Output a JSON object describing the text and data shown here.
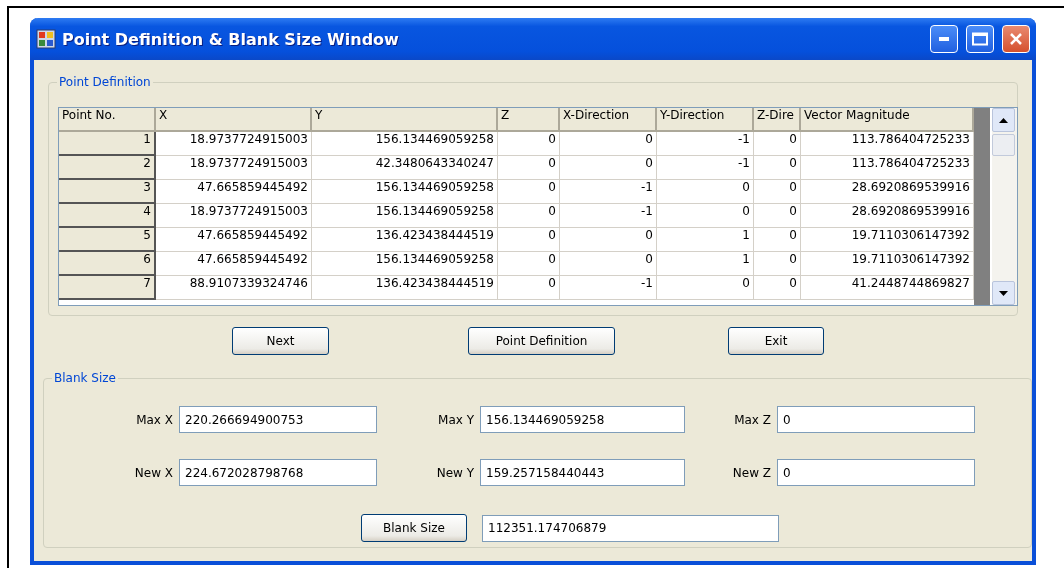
{
  "window": {
    "title": "Point Definition & Blank Size Window"
  },
  "point_definition": {
    "title": "Point Definition",
    "table": {
      "columns": [
        "Point No.",
        "X",
        "Y",
        "Z",
        "X-Direction",
        "Y-Direction",
        "Z-Dire",
        "Vector Magnitude"
      ],
      "rows": [
        [
          "1",
          "18.9737724915003",
          "156.134469059258",
          "0",
          "0",
          "-1",
          "0",
          "113.786404725233"
        ],
        [
          "2",
          "18.9737724915003",
          "42.3480643340247",
          "0",
          "0",
          "-1",
          "0",
          "113.786404725233"
        ],
        [
          "3",
          "47.665859445492",
          "156.134469059258",
          "0",
          "-1",
          "0",
          "0",
          "28.6920869539916"
        ],
        [
          "4",
          "18.9737724915003",
          "156.134469059258",
          "0",
          "-1",
          "0",
          "0",
          "28.6920869539916"
        ],
        [
          "5",
          "47.665859445492",
          "136.423438444519",
          "0",
          "0",
          "1",
          "0",
          "19.7110306147392"
        ],
        [
          "6",
          "47.665859445492",
          "156.134469059258",
          "0",
          "0",
          "1",
          "0",
          "19.7110306147392"
        ],
        [
          "7",
          "88.9107339324746",
          "136.423438444519",
          "0",
          "-1",
          "0",
          "0",
          "41.2448744869827"
        ]
      ]
    }
  },
  "buttons": [
    "Next",
    "Point Definition",
    "Exit"
  ],
  "blank_size": {
    "title": "Blank Size",
    "fields": [
      {
        "label": "Max X",
        "value": "220.266694900753"
      },
      {
        "label": "Max Y",
        "value": "156.134469059258"
      },
      {
        "label": "Max Z",
        "value": "0"
      },
      {
        "label": "New X",
        "value": "224.672028798768"
      },
      {
        "label": "New Y",
        "value": "159.257158440443"
      },
      {
        "label": "New Z",
        "value": "0"
      }
    ],
    "button": "Blank Size",
    "result": "112351.174706879"
  }
}
